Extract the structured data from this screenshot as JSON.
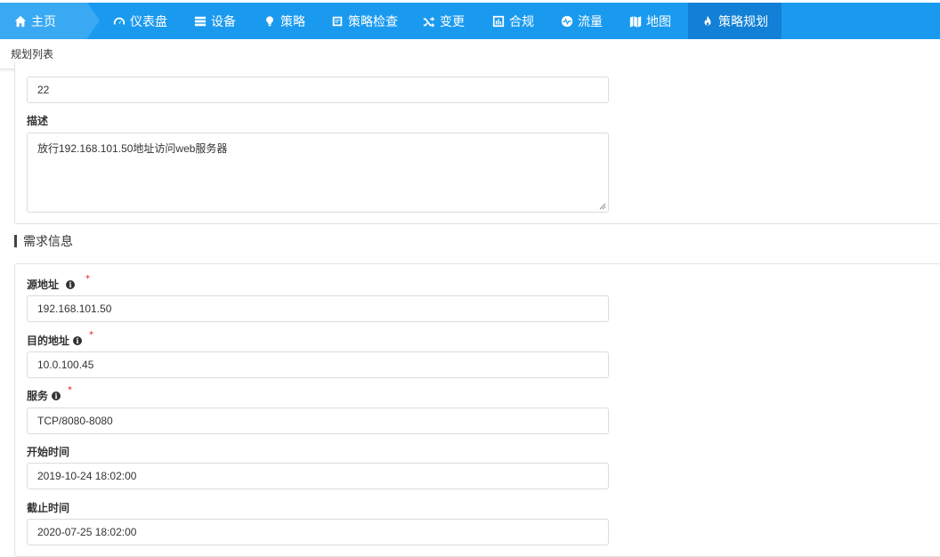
{
  "nav": {
    "home": "主页",
    "items": [
      {
        "label": "仪表盘",
        "icon": "dashboard-icon"
      },
      {
        "label": "设备",
        "icon": "server-icon"
      },
      {
        "label": "策略",
        "icon": "lightbulb-icon"
      },
      {
        "label": "策略检查",
        "icon": "checklist-icon"
      },
      {
        "label": "变更",
        "icon": "shuffle-icon"
      },
      {
        "label": "合规",
        "icon": "bar-chart-icon"
      },
      {
        "label": "流量",
        "icon": "pulse-icon"
      },
      {
        "label": "地图",
        "icon": "map-icon"
      },
      {
        "label": "策略规划",
        "icon": "fire-icon"
      }
    ],
    "active_index": 8,
    "colors": {
      "bar": "#1a9aef",
      "home": "#3aa9f3",
      "active": "#1180d6"
    }
  },
  "breadcrumb": "规划列表",
  "top_form": {
    "partial_value": "22",
    "description_label": "描述",
    "description_value": "放行192.168.101.50地址访问web服务器"
  },
  "requirement": {
    "section_title": "需求信息",
    "source_label": "源地址",
    "source_value": "192.168.101.50",
    "dest_label": "目的地址",
    "dest_value": "10.0.100.45",
    "service_label": "服务",
    "service_value": "TCP/8080-8080",
    "start_label": "开始时间",
    "start_value": "2019-10-24 18:02:00",
    "end_label": "截止时间",
    "end_value": "2020-07-25 18:02:00",
    "required_mark": "*"
  }
}
